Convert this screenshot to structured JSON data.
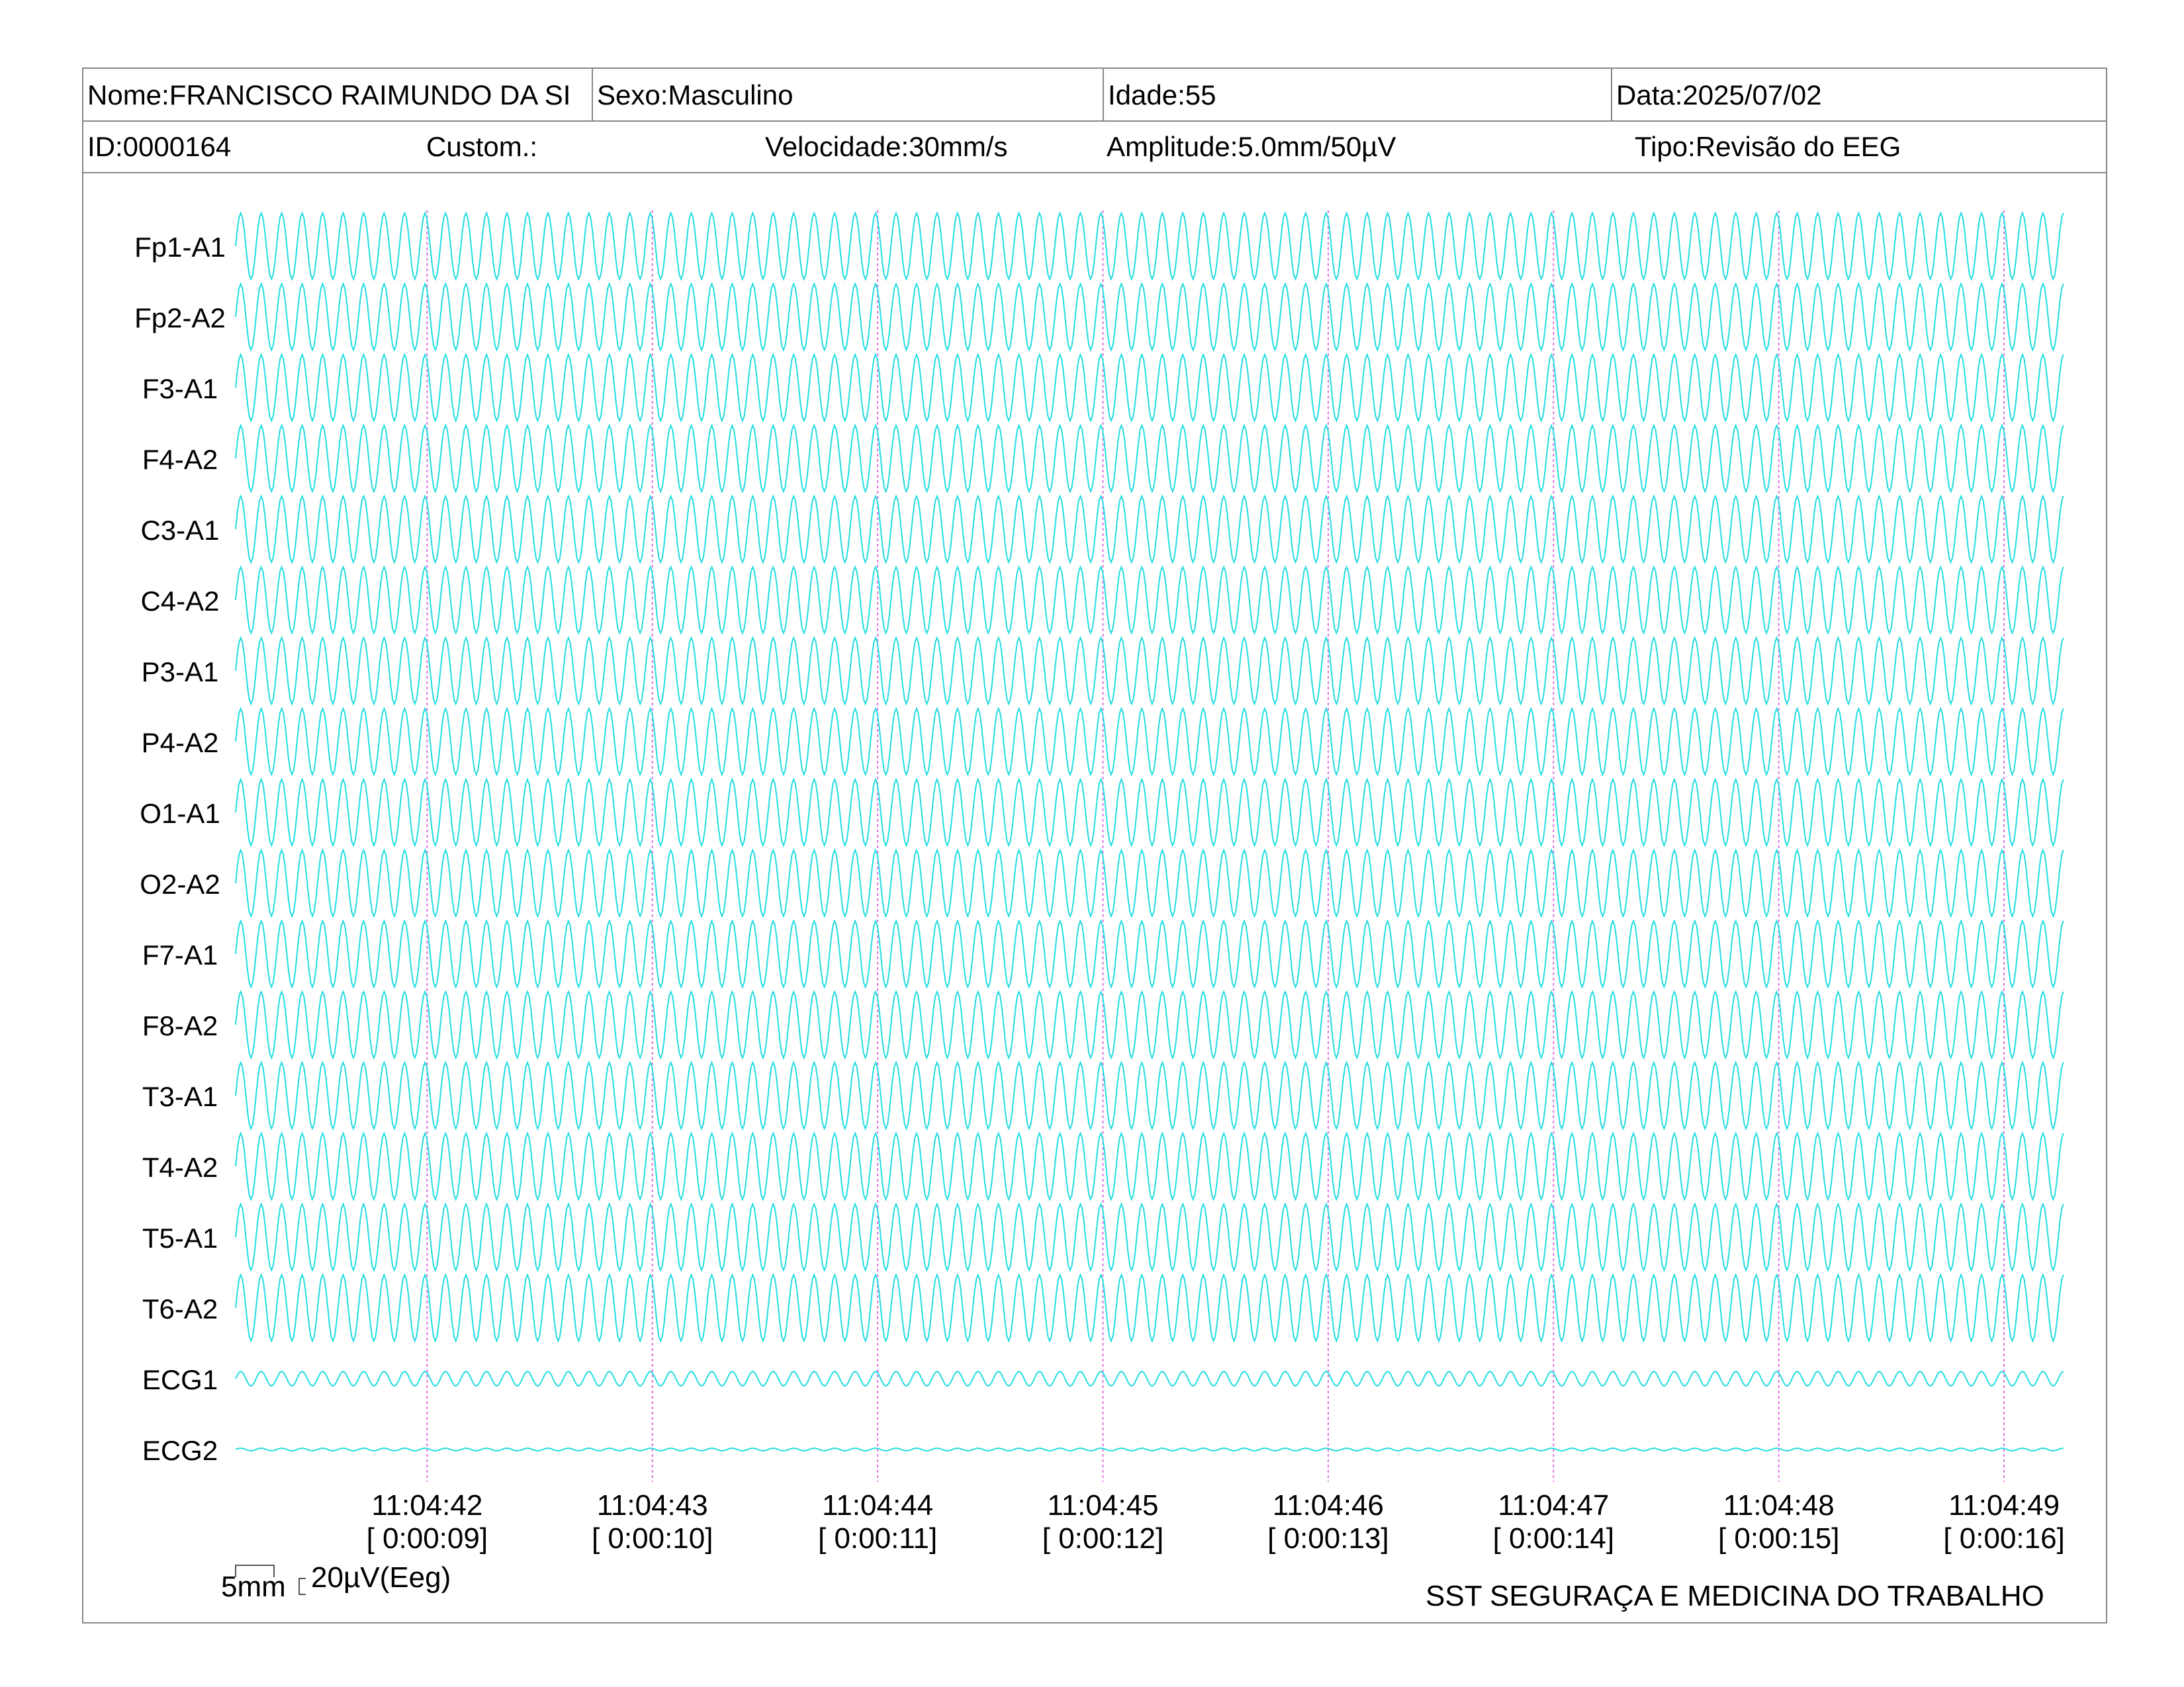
{
  "header": {
    "name": "Nome:FRANCISCO RAIMUNDO DA SI",
    "sex": "Sexo:Masculino",
    "age": "Idade:55",
    "date": "Data:2025/07/02",
    "id": "ID:0000164",
    "custom": "Custom.:",
    "speed": "Velocidade:30mm/s",
    "amplitude": "Amplitude:5.0mm/50µV",
    "type": "Tipo:Revisão do EEG"
  },
  "scale": {
    "time_label": "5mm",
    "amp_label": "20µV(Eeg)"
  },
  "footer": {
    "org": "SST SEGURAÇA E MEDICINA DO TRABALHO"
  },
  "colors": {
    "trace": "#22dde0",
    "marker": "#e070e0",
    "border": "#888888"
  },
  "chart_data": {
    "type": "line",
    "channels": [
      "Fp1-A1",
      "Fp2-A2",
      "F3-A1",
      "F4-A2",
      "C3-A1",
      "C4-A2",
      "P3-A1",
      "P4-A2",
      "O1-A1",
      "O2-A2",
      "F7-A1",
      "F8-A2",
      "T3-A1",
      "T4-A2",
      "T5-A1",
      "T6-A2",
      "ECG1",
      "ECG2"
    ],
    "amplitude_uv": [
      50,
      50,
      50,
      50,
      50,
      50,
      50,
      50,
      50,
      50,
      50,
      50,
      50,
      50,
      50,
      50,
      11,
      2
    ],
    "oscillation_hz": 11,
    "time_ticks": [
      {
        "clock": "11:04:42",
        "elapsed": "[ 0:00:09]"
      },
      {
        "clock": "11:04:43",
        "elapsed": "[ 0:00:10]"
      },
      {
        "clock": "11:04:44",
        "elapsed": "[ 0:00:11]"
      },
      {
        "clock": "11:04:45",
        "elapsed": "[ 0:00:12]"
      },
      {
        "clock": "11:04:46",
        "elapsed": "[ 0:00:13]"
      },
      {
        "clock": "11:04:47",
        "elapsed": "[ 0:00:14]"
      },
      {
        "clock": "11:04:48",
        "elapsed": "[ 0:00:15]"
      },
      {
        "clock": "11:04:49",
        "elapsed": "[ 0:00:16]"
      }
    ],
    "x_range_s": [
      8.15,
      16.27
    ]
  }
}
